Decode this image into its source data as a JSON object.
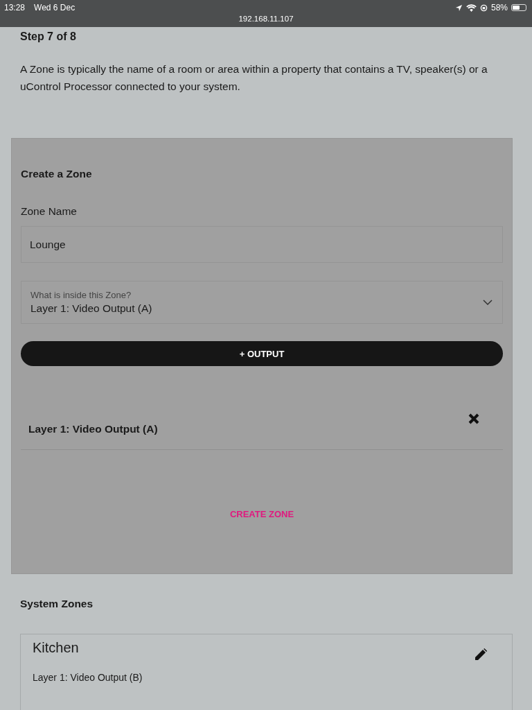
{
  "status_bar": {
    "time": "13:28",
    "date": "Wed 6 Dec",
    "battery": "58%",
    "url": "192.168.11.107"
  },
  "step": {
    "title": "Step 7 of 8",
    "intro": "A Zone is typically the name of a room or area within a property that contains a TV, speaker(s) or a uControl Processor connected to your system."
  },
  "create_zone": {
    "title": "Create a Zone",
    "name_label": "Zone Name",
    "name_value": "Lounge",
    "select": {
      "label": "What is inside this Zone?",
      "value": "Layer 1: Video Output (A)"
    },
    "add_button": "+ OUTPUT",
    "outputs": [
      {
        "name": "Layer 1: Video Output (A)"
      }
    ],
    "create_button": "CREATE ZONE"
  },
  "system_zones": {
    "title": "System Zones",
    "zones": [
      {
        "name": "Kitchen",
        "outputs": [
          "Layer 1: Video Output (B)"
        ]
      }
    ]
  }
}
